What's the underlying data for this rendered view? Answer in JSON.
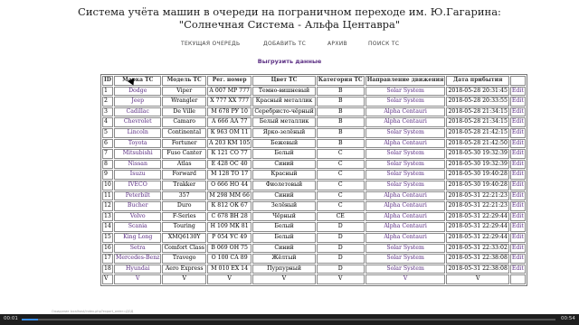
{
  "title": "Система учёта машин в очереди на пограничном переходе им. Ю.Гагарина: \"Солнечная Система - Альфа Центавра\"",
  "nav": [
    "ТЕКУЩАЯ ОЧЕРЕДЬ",
    "ДОБАВИТЬ ТС",
    "АРХИВ",
    "ПОИСК ТС"
  ],
  "export_label": "Выгрузить данные",
  "table": {
    "headers": [
      "ID",
      "Марка ТС",
      "Модель ТС",
      "Рег. номер",
      "Цвет ТС",
      "Категория ТС",
      "Направление движения",
      "Дата прибытия",
      ""
    ],
    "rows": [
      [
        "1",
        "Dodge",
        "Viper",
        "А 007 МР 777",
        "Темно-вишневый",
        "B",
        "Solar System",
        "2018-05-28 20:31:45",
        "Edit"
      ],
      [
        "2",
        "Jeep",
        "Wrangler",
        "Х 777 ХХ 777",
        "Красный металлик",
        "B",
        "Solar System",
        "2018-05-28 20:33:55",
        "Edit"
      ],
      [
        "3",
        "Cadillac",
        "De Ville",
        "М 678 РУ 10",
        "Серебристо-чёрный",
        "B",
        "Alpha Centauri",
        "2018-05-28 21:34:15",
        "Edit"
      ],
      [
        "4",
        "Chevrolet",
        "Camaro",
        "А 666 АА 77",
        "Белый металлик",
        "B",
        "Alpha Centauri",
        "2018-05-28 21:34:15",
        "Edit"
      ],
      [
        "5",
        "Lincoln",
        "Continental",
        "К 963 ОМ 11",
        "Ярко-зелёный",
        "B",
        "Solar System",
        "2018-05-28 21:42:15",
        "Edit"
      ],
      [
        "6",
        "Toyota",
        "Fortuner",
        "А 203 КМ 105",
        "Бежевый",
        "B",
        "Alpha Centauri",
        "2018-05-28 21:42:50",
        "Edit"
      ],
      [
        "7",
        "Mitsubishi",
        "Fuso Canter",
        "К 121 СО 77",
        "Белый",
        "C",
        "Solar System",
        "2018-05-30 19:32:39",
        "Edit"
      ],
      [
        "8",
        "Nissan",
        "Atlas",
        "Е 428 ОС 40",
        "Синий",
        "C",
        "Solar System",
        "2018-05-30 19:32:39",
        "Edit"
      ],
      [
        "9",
        "Isuzu",
        "Forward",
        "М 128 ТО 17",
        "Красный",
        "C",
        "Solar System",
        "2018-05-30 19:40:28",
        "Edit"
      ],
      [
        "10",
        "IVECO",
        "Trakker",
        "О 666 НО 44",
        "Фиолетовый",
        "C",
        "Solar System",
        "2018-05-30 19:40:28",
        "Edit"
      ],
      [
        "11",
        "Peterbilt",
        "357",
        "М 298 ММ 66",
        "Синий",
        "C",
        "Alpha Centauri",
        "2018-05-31 22:21:23",
        "Edit"
      ],
      [
        "12",
        "Bucher",
        "Duro",
        "К 812 ОК 67",
        "Зелёный",
        "C",
        "Alpha Centauri",
        "2018-05-31 22:21:23",
        "Edit"
      ],
      [
        "13",
        "Volvo",
        "F-Series",
        "С 678 ВН 28",
        "Чёрный",
        "CE",
        "Alpha Centauri",
        "2018-05-31 22:29:44",
        "Edit"
      ],
      [
        "14",
        "Scania",
        "Touring",
        "Н 109 МК 81",
        "Белый",
        "D",
        "Alpha Centauri",
        "2018-05-31 22:29:44",
        "Edit"
      ],
      [
        "15",
        "King Long",
        "XMQ6130Y",
        "Р 054 УС 49",
        "Белый",
        "D",
        "Alpha Centauri",
        "2018-05-31 22:29:44",
        "Edit"
      ],
      [
        "16",
        "Setra",
        "Comfort Class",
        "В 069 ОН 75",
        "Синий",
        "D",
        "Solar System",
        "2018-05-31 22:33:02",
        "Edit"
      ],
      [
        "17",
        "Mercedes-Benz",
        "Travego",
        "О 100 СА 89",
        "Жёлтый",
        "D",
        "Solar System",
        "2018-05-31 22:38:08",
        "Edit"
      ],
      [
        "18",
        "Hyundai",
        "Aero Express",
        "М 010 ЕХ 14",
        "Пурпурный",
        "D",
        "Solar System",
        "2018-05-31 22:38:08",
        "Edit"
      ],
      [
        "V",
        "V",
        "V",
        "V",
        "V",
        "V",
        "V",
        "V",
        ""
      ]
    ]
  },
  "player": {
    "current_time": "00:01",
    "total_time": "00:54",
    "progress_percent": 3
  },
  "statusbar_text": "Ожидание localhost/index.php?export_order=ДОД"
}
